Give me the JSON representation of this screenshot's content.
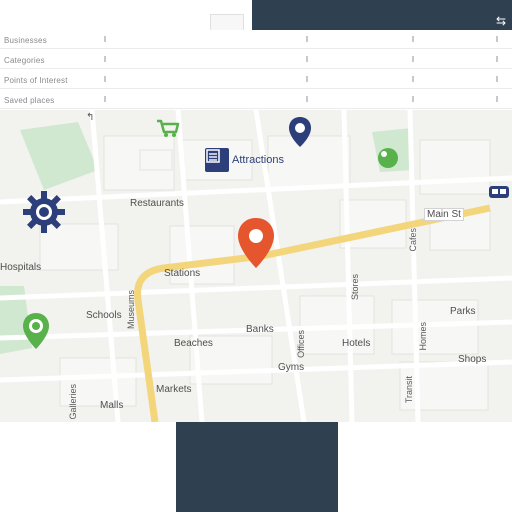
{
  "window": {
    "action_icon": "filter-icon",
    "action_label": "⇆"
  },
  "filter_panel": {
    "rows": [
      {
        "label": "Businesses"
      },
      {
        "label": "Categories"
      },
      {
        "label": "Points of Interest"
      },
      {
        "label": "Saved places"
      }
    ]
  },
  "map": {
    "labels": [
      {
        "text": "Attractions"
      },
      {
        "text": "Restaurants"
      },
      {
        "text": "Stations"
      },
      {
        "text": "Hospitals"
      },
      {
        "text": "Schools"
      },
      {
        "text": "Banks"
      },
      {
        "text": "Beaches"
      },
      {
        "text": "Hotels"
      },
      {
        "text": "Parks"
      },
      {
        "text": "Markets"
      },
      {
        "text": "Malls"
      },
      {
        "text": "Shops"
      },
      {
        "text": "Gyms"
      },
      {
        "text": "Museums"
      },
      {
        "text": "Cafes"
      },
      {
        "text": "Stores"
      },
      {
        "text": "Offices"
      },
      {
        "text": "Homes"
      },
      {
        "text": "Transit"
      },
      {
        "text": "Galleries"
      }
    ],
    "road_label": "Main St",
    "markers": {
      "primary": {
        "icon": "location-pin-icon",
        "color": "#e5552e"
      },
      "secondary": {
        "icon": "location-pin-icon",
        "color": "#2d3f7a"
      },
      "building": {
        "icon": "building-icon",
        "color": "#2d3f7a"
      },
      "settings": {
        "icon": "gear-icon",
        "color": "#2d3f7a"
      },
      "park": {
        "icon": "park-icon",
        "color": "#58b14b"
      },
      "green_pin": {
        "icon": "location-pin-icon",
        "color": "#58b14b"
      },
      "cart": {
        "icon": "cart-icon",
        "color": "#58b14b"
      },
      "bus": {
        "icon": "bus-icon",
        "color": "#2d3f7a"
      }
    },
    "colors": {
      "main_road": "#f3d67b",
      "road": "#ffffff",
      "park": "#cfe8cf",
      "map_bg": "#f2f2ef"
    }
  }
}
